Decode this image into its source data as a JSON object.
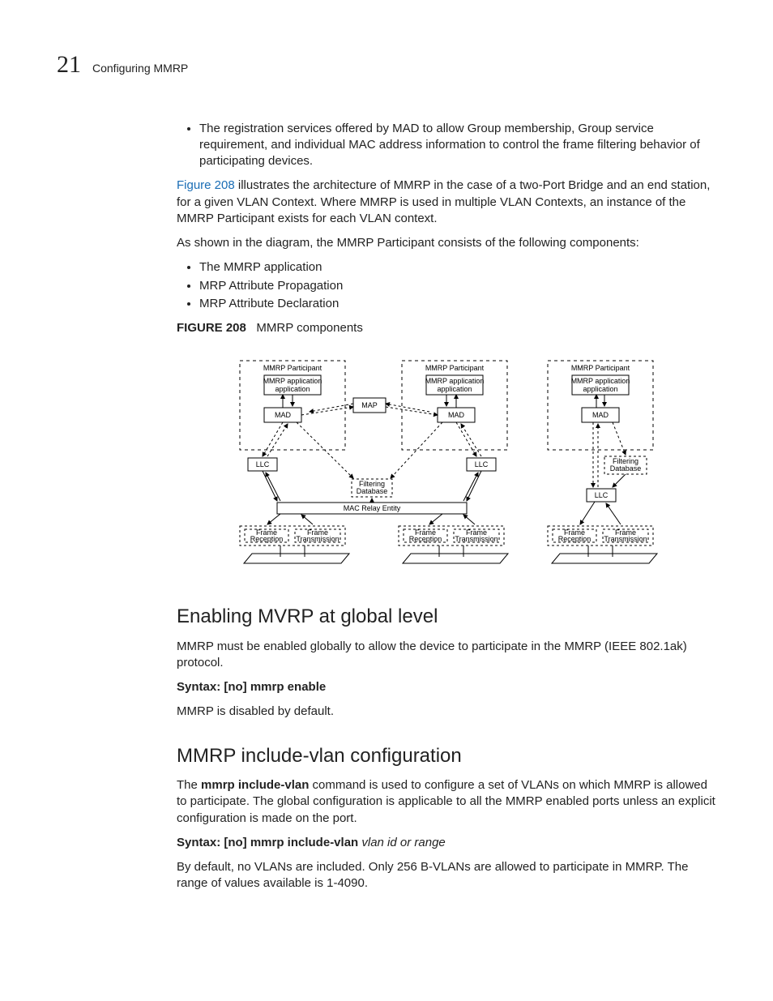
{
  "header": {
    "chapter_number": "21",
    "chapter_title": "Configuring MMRP"
  },
  "intro_bullet": "The registration services offered by MAD to allow Group membership, Group service requirement, and individual MAC address information to control the frame filtering behavior of participating devices.",
  "figref_link": "Figure 208",
  "figref_rest": " illustrates the architecture of MMRP in the case of a two-Port Bridge and an end station, for a given VLAN Context. Where MMRP is used in multiple VLAN Contexts, an instance of the MMRP Participant exists for each VLAN context.",
  "components_intro": "As shown in the diagram, the MMRP Participant consists of the following components:",
  "components": [
    "The MMRP application",
    "MRP Attribute Propagation",
    "MRP Attribute Declaration"
  ],
  "figure": {
    "label": "FIGURE 208",
    "caption": "MMRP components",
    "labels": {
      "participant": "MMRP Participant",
      "app": "MMRP application",
      "mad": "MAD",
      "map": "MAP",
      "llc": "LLC",
      "filtdb": "Filtering Database",
      "macrelay": "MAC Relay Entity",
      "rx": "Frame Reception",
      "tx": "Frame Transmission"
    }
  },
  "section1": {
    "heading": "Enabling MVRP at global level",
    "para": "MMRP must be enabled globally to allow the device to participate in the MMRP (IEEE 802.1ak) protocol.",
    "syntax_label": "Syntax:  ",
    "syntax": "[no] mmrp enable",
    "default": "MMRP is disabled by default."
  },
  "section2": {
    "heading": "MMRP include-vlan configuration",
    "para_pre": "The ",
    "para_cmd": "mmrp include-vlan",
    "para_post": " command is used to configure a set of VLANs on which MMRP is allowed to participate. The global configuration is applicable to all the MMRP enabled ports unless an explicit configuration is made on the port.",
    "syntax_label": "Syntax:  ",
    "syntax_bold": "[no] mmrp include-vlan",
    "syntax_ital": " vlan id or range",
    "default": "By default, no VLANs are included. Only 256 B-VLANs are allowed to participate in MMRP. The range of values available is 1-4090."
  }
}
